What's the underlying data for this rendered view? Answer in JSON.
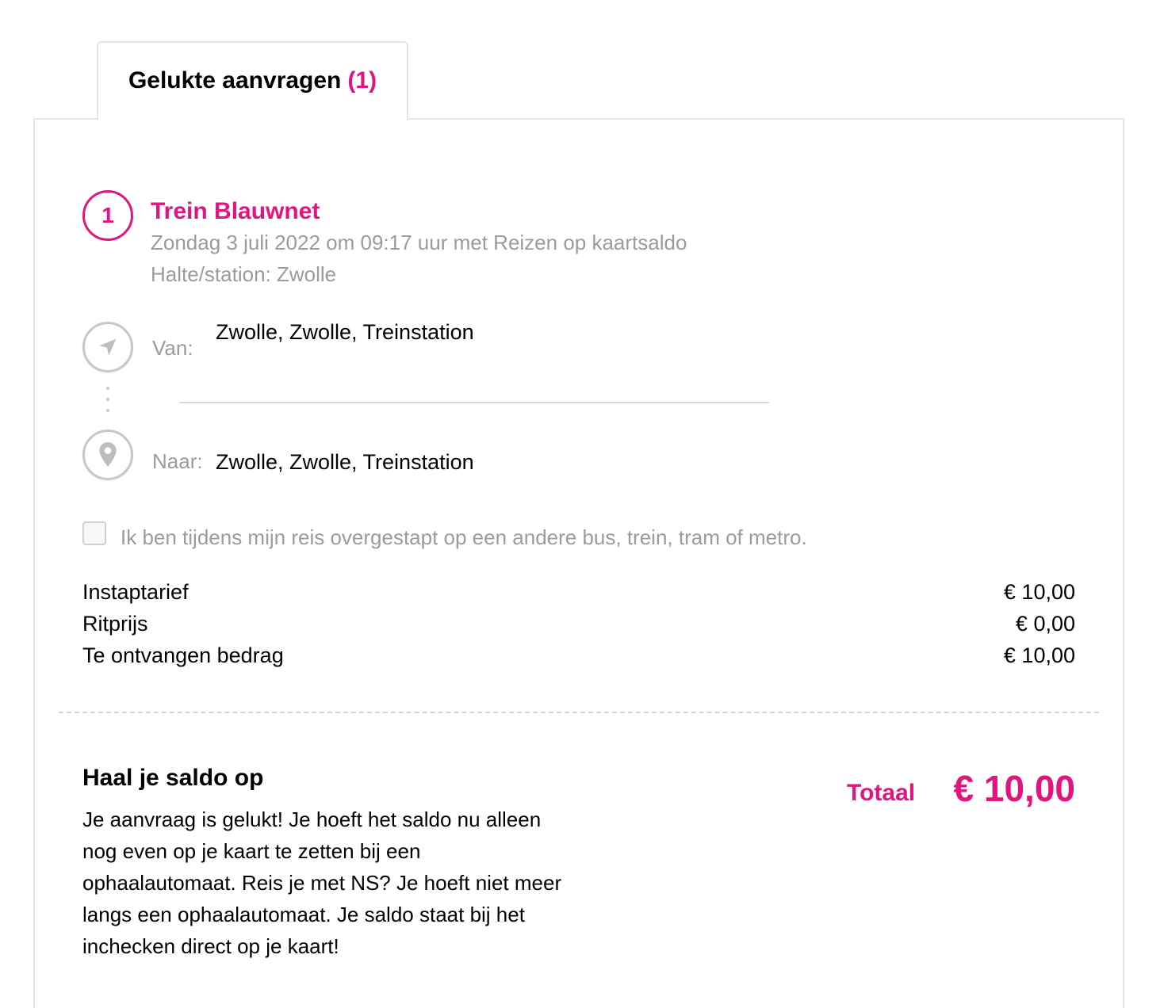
{
  "tab": {
    "label": "Gelukte aanvragen",
    "count": "(1)"
  },
  "trip": {
    "number": "1",
    "title": "Trein Blauwnet",
    "subtitle": "Zondag 3 juli 2022 om 09:17 uur met Reizen op kaartsaldo",
    "stop": "Halte/station: Zwolle",
    "from_label": "Van:",
    "from_value": "Zwolle, Zwolle, Treinstation",
    "to_label": "Naar:",
    "to_value": "Zwolle, Zwolle, Treinstation",
    "from_icon": "navigation-arrow-icon",
    "to_icon": "map-pin-icon"
  },
  "transfer": {
    "checked": false,
    "label": "Ik ben tijdens mijn reis overgestapt op een andere bus, trein, tram of metro."
  },
  "prices": [
    {
      "label": "Instaptarief",
      "value": "€ 10,00"
    },
    {
      "label": "Ritprijs",
      "value": "€ 0,00"
    },
    {
      "label": "Te ontvangen bedrag",
      "value": "€ 10,00"
    }
  ],
  "summary": {
    "title": "Haal je saldo op",
    "text": "Je aanvraag is gelukt! Je hoeft het saldo nu alleen nog even op je kaart te zetten bij een ophaalautomaat. Reis je met NS? Je hoeft niet meer langs een ophaalautomaat. Je saldo staat bij het inchecken direct op je kaart!",
    "total_label": "Totaal",
    "total_value": "€ 10,00"
  },
  "colors": {
    "accent": "#e2157f",
    "muted_text": "#9b9b9b",
    "border": "#e6e6e6"
  }
}
